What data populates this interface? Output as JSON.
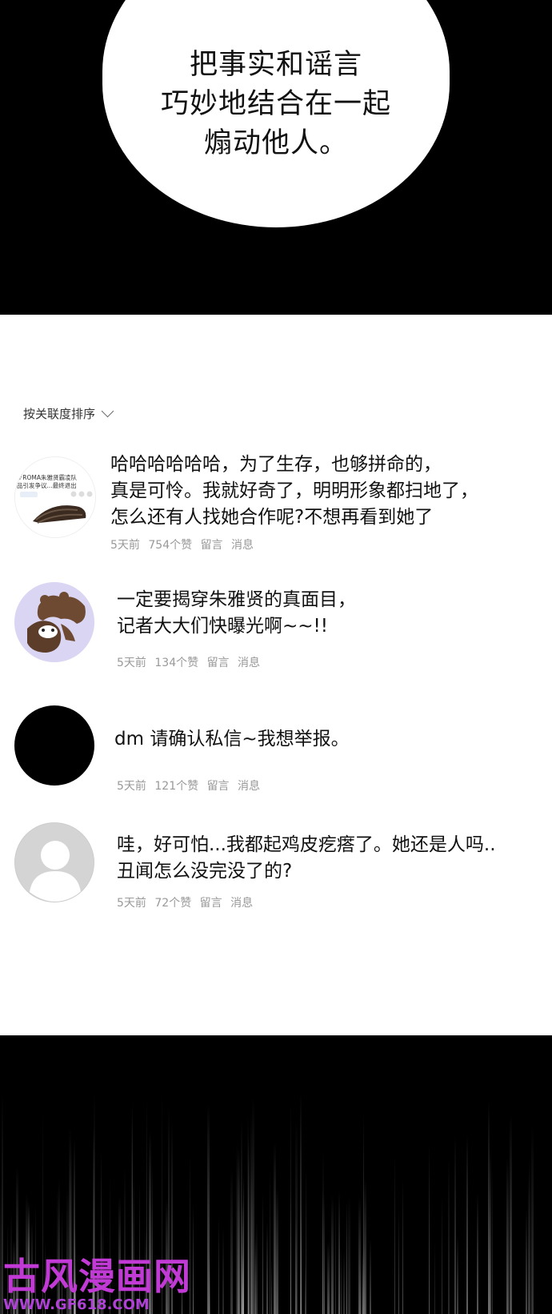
{
  "bubble": {
    "lines": [
      "把事实和谣言",
      "巧妙地结合在一起",
      "煽动他人。"
    ]
  },
  "sort": {
    "label": "按关联度排序"
  },
  "comments": [
    {
      "lines": [
        "哈哈哈哈哈哈，为了生存，也够拼命的，",
        "真是可怜。我就好奇了，明明形象都扫地了，",
        "怎么还有人找她合作呢?不想再看到她了"
      ],
      "time": "5天前",
      "likes": "754个赞",
      "reply": "留言",
      "message": "消息",
      "thumb_text": [
        "[FROMA朱雅贤霸凌队",
        "品引发争议...最终退出"
      ]
    },
    {
      "lines": [
        "一定要揭穿朱雅贤的真面目，",
        "记者大大们快曝光啊~~!!"
      ],
      "time": "5天前",
      "likes": "134个赞",
      "reply": "留言",
      "message": "消息"
    },
    {
      "lines": [
        "dm 请确认私信~我想举报。"
      ],
      "time": "5天前",
      "likes": "121个赞",
      "reply": "留言",
      "message": "消息"
    },
    {
      "lines": [
        "哇，好可怕...我都起鸡皮疙瘩了。她还是人吗..",
        "丑闻怎么没完没了的?"
      ],
      "time": "5天前",
      "likes": "72个赞",
      "reply": "留言",
      "message": "消息"
    }
  ],
  "watermark": {
    "name": "古风漫画网",
    "url": "WWW.GF618.COM"
  },
  "colors": {
    "watermark": "#c23ad6",
    "avatar2_bg": "#d9d5f3",
    "avatar4_bg": "#d4d4d4"
  }
}
